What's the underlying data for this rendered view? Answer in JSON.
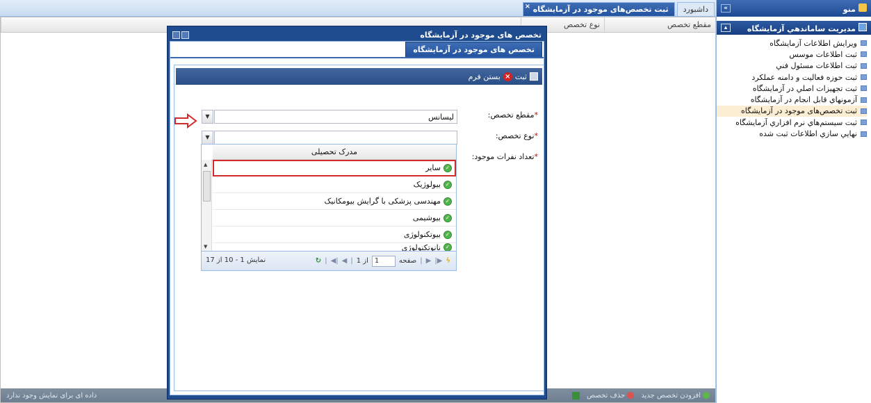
{
  "sidebar": {
    "title": "منو",
    "group_title": "مديريت ساماندهي آزمايشگاه",
    "items": [
      {
        "label": "ويرايش اطلاعات آزمايشگاه"
      },
      {
        "label": "ثبت اطلاعات موسس"
      },
      {
        "label": "ثبت اطلاعات مسئول فني"
      },
      {
        "label": "ثبت حوزه فعاليت و دامنه عملكرد"
      },
      {
        "label": "ثبت تجهيزات اصلي در آزمايشگاه"
      },
      {
        "label": "آزمونهاي قابل انجام در آزمايشگاه"
      },
      {
        "label": "ثبت تخصص‌های موجود در آزمایشگاه",
        "selected": true
      },
      {
        "label": "ثبت سيستم‌هاي نرم افزاري آزمايشگاه"
      },
      {
        "label": "نهايي سازي اطلاعات ثبت شده"
      }
    ]
  },
  "tabs": {
    "dashboard": "داشبورد",
    "active": "ثبت تخصص‌های موجود در آزمایشگاه"
  },
  "grid": {
    "columns": [
      "مقطع تخصص",
      "نوع تخصص"
    ],
    "empty_text": "داده ای برای نمایش وجود ندارد",
    "add_label": "افزودن تخصص جدید",
    "delete_label": "حذف تخصص"
  },
  "window": {
    "title": "تخصص های موجود در آزمایشگاه",
    "tab_label": "تخصص های موجود در آزمایشگاه",
    "toolbar": {
      "save": "ثبت",
      "close": "بستن فرم"
    }
  },
  "form": {
    "degree_label": "مقطع تخصص:",
    "degree_value": "لیسانس",
    "type_label": "نوع تخصص:",
    "type_value": "",
    "count_label": "تعداد نفرات موجود:"
  },
  "dropdown": {
    "header": "مدرک تحصیلی",
    "options": [
      "سایر",
      "بیولوژیک",
      "مهندسی پزشکی با گرایش بیومکانیک",
      "بیوشیمی",
      "بیوتکنولوژی",
      "نانوتکنولوژی"
    ],
    "highlighted_index": 0,
    "pager": {
      "page_label": "صفحه",
      "page_value": "1",
      "of_label": "از 1",
      "info": "نمایش 1 - 10 از 17"
    }
  },
  "colors": {
    "header_blue": "#1f4b8f",
    "accent_red": "#d12b2b",
    "selected_bg": "#fbeed2"
  }
}
